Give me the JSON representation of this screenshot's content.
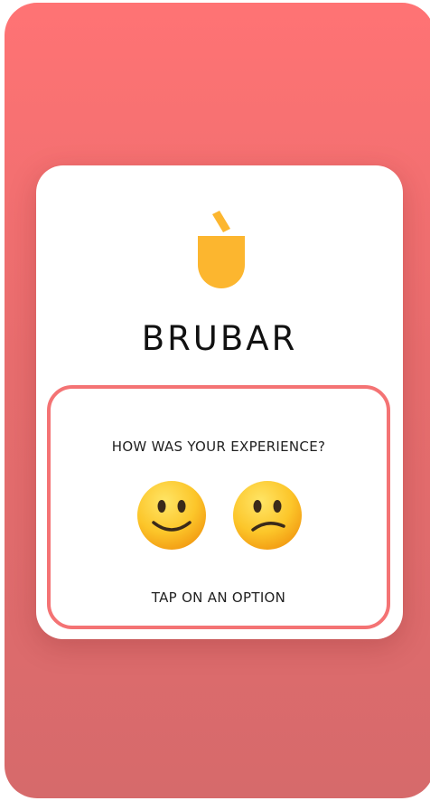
{
  "brand": {
    "name": "BRUBAR",
    "logo_icon": "cup-icon",
    "logo_color": "#fcb62f"
  },
  "rating": {
    "question": "HOW WAS YOUR EXPERIENCE?",
    "hint": "TAP ON AN OPTION",
    "options": [
      {
        "name": "happy-face-icon",
        "label": "slightly smiling face"
      },
      {
        "name": "confused-face-icon",
        "label": "confused face"
      }
    ],
    "border_color": "#f47374"
  },
  "theme": {
    "background_top": "#ff7374",
    "background_bottom": "#d66a6b"
  }
}
